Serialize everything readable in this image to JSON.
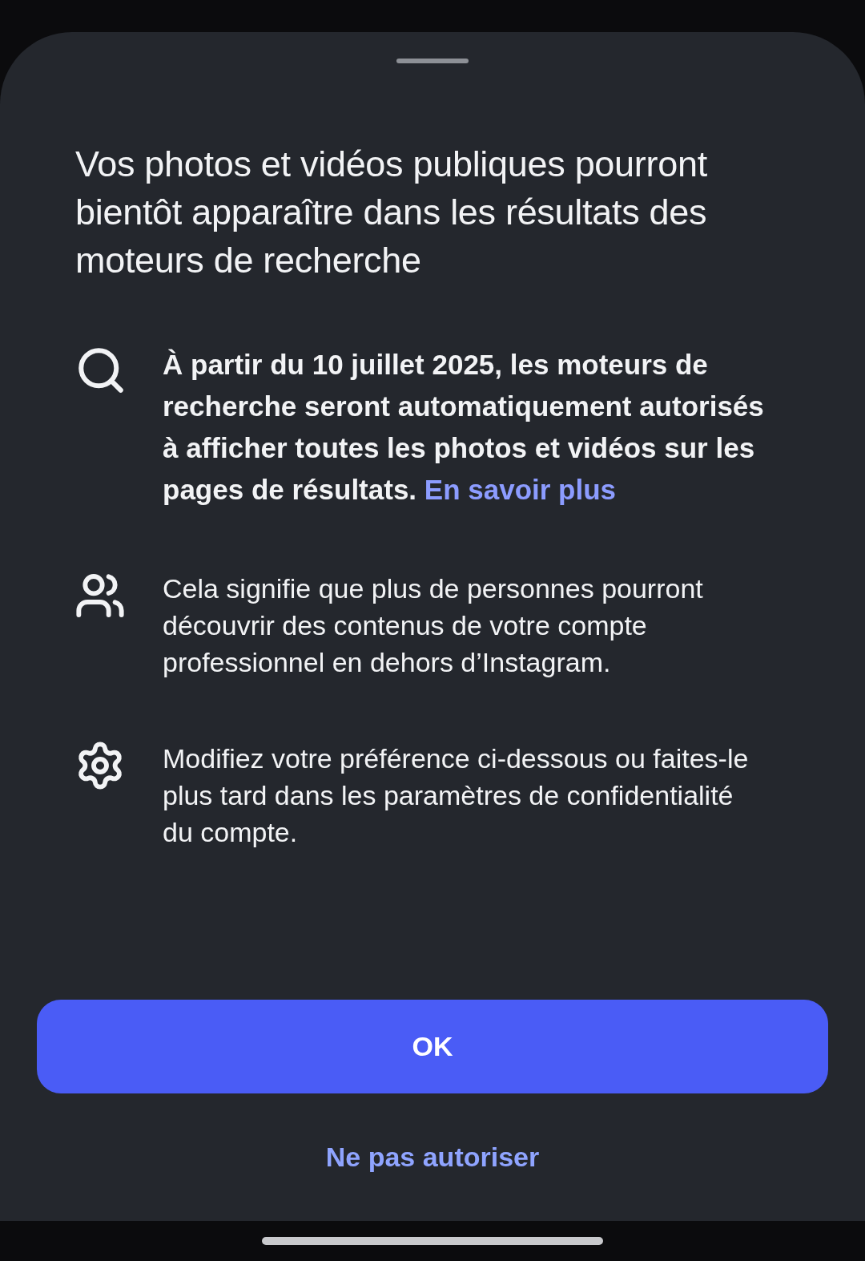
{
  "sheet": {
    "title": "Vos photos et vidéos publiques pourront bientôt apparaître dans les résultats des moteurs de recherche",
    "items": [
      {
        "kind": "search",
        "emphasis": true,
        "text": "À partir du 10 juillet 2025, les moteurs de recherche seront automatiquement autorisés à afficher toutes les photos et vidéos sur les pages de résultats.",
        "link": "En savoir plus"
      },
      {
        "kind": "people",
        "emphasis": false,
        "text": "Cela signifie que plus de personnes pourront découvrir des contenus de votre compte professionnel en dehors d’Instagram."
      },
      {
        "kind": "settings",
        "emphasis": false,
        "text": "Modifiez votre préférence ci-dessous ou faites-le plus tard dans les paramètres de confidentialité du compte."
      }
    ],
    "primary_button": "OK",
    "secondary_button": "Ne pas autoriser"
  }
}
